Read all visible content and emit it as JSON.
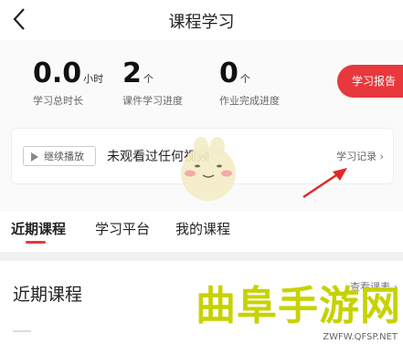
{
  "header": {
    "title": "课程学习"
  },
  "stats": [
    {
      "value": "0.0",
      "unit": "小时",
      "label": "学习总时长"
    },
    {
      "value": "2",
      "unit": "个",
      "label": "课件学习进度"
    },
    {
      "value": "0",
      "unit": "个",
      "label": "作业完成进度"
    }
  ],
  "report_button": "学习报告",
  "video_card": {
    "continue_label": "继续播放",
    "message": "未观看过任何视频",
    "record_link": "学习记录 ›"
  },
  "tabs": [
    "近期课程",
    "学习平台",
    "我的课程"
  ],
  "recent": {
    "title": "近期课程",
    "view_all": "查看课表 ›"
  },
  "watermark": {
    "text": "曲阜手游网",
    "url": "ZWFW.QFSP.NET"
  },
  "colors": {
    "accent": "#e8383d",
    "watermark": "#c7d200"
  }
}
